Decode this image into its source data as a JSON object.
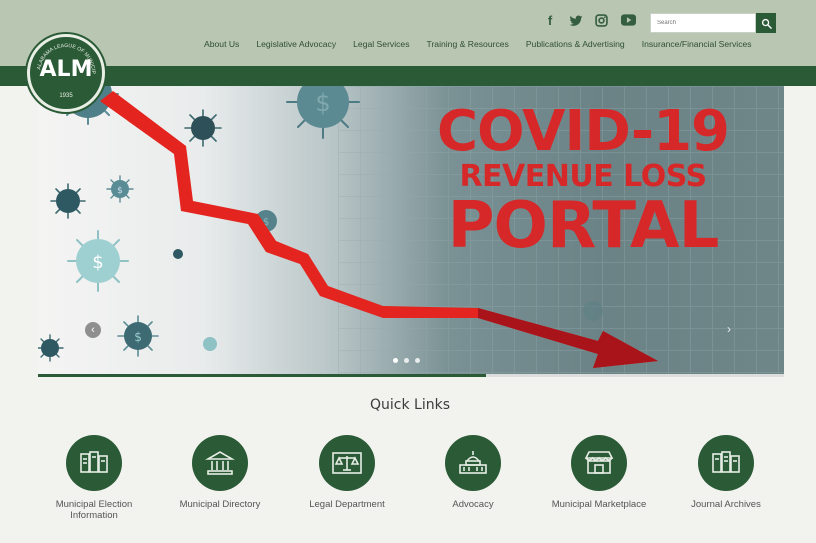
{
  "logo": {
    "abbr": "ALM",
    "ring_text": "ALABAMA LEAGUE OF MUNICIPALITIES",
    "year": "1935"
  },
  "social": [
    {
      "icon": "facebook-icon",
      "glyph": "f"
    },
    {
      "icon": "twitter-icon",
      "glyph": ""
    },
    {
      "icon": "instagram-icon",
      "glyph": ""
    },
    {
      "icon": "youtube-icon",
      "glyph": ""
    }
  ],
  "search": {
    "placeholder": "Search"
  },
  "nav": {
    "items": [
      {
        "label": "About Us"
      },
      {
        "label": "Legislative Advocacy"
      },
      {
        "label": "Legal Services"
      },
      {
        "label": "Training & Resources"
      },
      {
        "label": "Publications & Advertising"
      },
      {
        "label": "Insurance/Financial Services"
      }
    ]
  },
  "hero": {
    "line1": "COVID-19",
    "line2": "REVENUE LOSS",
    "line3": "PORTAL",
    "prev": "‹",
    "next": "›",
    "slide_count": 3,
    "active_slide": 1
  },
  "carousel_progress": 0.6,
  "quick_links": {
    "title": "Quick Links",
    "items": [
      {
        "label": "Municipal Election Information",
        "icon": "election-icon"
      },
      {
        "label": "Municipal Directory",
        "icon": "building-columns-icon"
      },
      {
        "label": "Legal Department",
        "icon": "scales-icon"
      },
      {
        "label": "Advocacy",
        "icon": "capitol-icon"
      },
      {
        "label": "Municipal Marketplace",
        "icon": "marketplace-icon"
      },
      {
        "label": "Journal Archives",
        "icon": "journal-icon"
      }
    ]
  },
  "colors": {
    "brand_green": "#2a5a36",
    "header_sage": "#b9c6b1",
    "hero_red": "#d62828"
  }
}
